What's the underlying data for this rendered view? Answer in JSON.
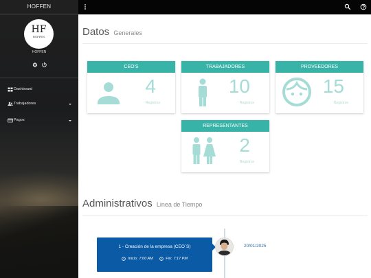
{
  "sidebar": {
    "brand": "HOFFEN",
    "logo": {
      "mark": "HF",
      "text": "HOFFEN"
    },
    "user_name": "HOFFEN",
    "items": [
      {
        "label": "Dashboard",
        "icon": "dashboard-icon"
      },
      {
        "label": "Trabajadores",
        "icon": "users-icon"
      },
      {
        "label": "Pagos",
        "icon": "credit-card-icon"
      }
    ]
  },
  "topbar": {
    "icons": [
      "more-vert-icon",
      "search-icon",
      "help-icon"
    ]
  },
  "datos": {
    "title": "Datos",
    "subtitle": "Generales",
    "cards": [
      {
        "label": "CEO'S",
        "value": "4",
        "caption": "Registros",
        "icon": "person-icon"
      },
      {
        "label": "TRABAJADORES",
        "value": "10",
        "caption": "Registros",
        "icon": "worker-icon"
      },
      {
        "label": "PROVEEDORES",
        "value": "15",
        "caption": "Registros",
        "icon": "face-icon"
      },
      {
        "label": "REPRESENTANTES",
        "value": "2",
        "caption": "Registros",
        "icon": "wc-icon"
      }
    ]
  },
  "administrativos": {
    "title": "Administrativos",
    "subtitle": "Linea de Tiempo",
    "event": {
      "title": "1 - Creación de la empresa (CEO´S)",
      "start_label": "Inicio:",
      "start_time": "7:00 AM",
      "end_label": "Fin:",
      "end_time": "7:17 PM",
      "date": "20/01/2025"
    }
  },
  "colors": {
    "accent": "#37b3a8",
    "accent_light": "#a6dcd6",
    "timeline_card": "#0a5aa6",
    "topbar": "#050505"
  }
}
